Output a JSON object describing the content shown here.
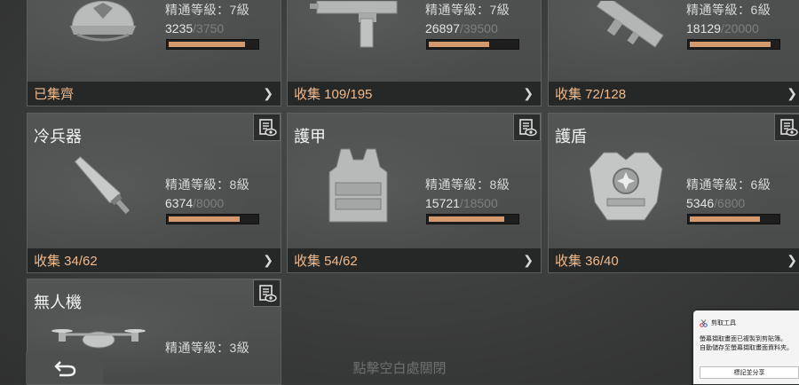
{
  "cards": [
    {
      "title": "",
      "level": "精通等級：7級",
      "exp_current": "3235",
      "exp_max": "/3750",
      "progress": 0.86,
      "collect": "已集齊",
      "icon": "helmet-icon"
    },
    {
      "title": "",
      "level": "精通等級：7級",
      "exp_current": "26897",
      "exp_max": "/39500",
      "progress": 0.68,
      "collect": "收集 109/195",
      "icon": "gun-icon"
    },
    {
      "title": "",
      "level": "精通等級：6級",
      "exp_current": "18129",
      "exp_max": "/20000",
      "progress": 0.91,
      "collect": "收集 72/128",
      "icon": "launcher-icon"
    },
    {
      "title": "冷兵器",
      "level": "精通等級：8級",
      "exp_current": "6374",
      "exp_max": "/8000",
      "progress": 0.8,
      "collect": "收集 34/62",
      "icon": "blade-icon"
    },
    {
      "title": "護甲",
      "level": "精通等級：8級",
      "exp_current": "15721",
      "exp_max": "/18500",
      "progress": 0.85,
      "collect": "收集 54/62",
      "icon": "armor-vest-icon"
    },
    {
      "title": "護盾",
      "level": "精通等級：6級",
      "exp_current": "5346",
      "exp_max": "/6800",
      "progress": 0.79,
      "collect": "收集 36/40",
      "icon": "shield-armor-icon"
    },
    {
      "title": "無人機",
      "level": "精通等級：3級",
      "icon": "drone-icon"
    }
  ],
  "bottom_hint": "點擊空白處關閉",
  "back_icon": "back-arrow-icon",
  "toast": {
    "app": "剪取工具",
    "message_line1": "螢幕擷取畫面已複製到剪貼簿。",
    "message_line2": "自動儲存至螢幕擷取畫面資料夾。",
    "button": "標記並分享"
  },
  "colors": {
    "accent": "#f0b98a",
    "bar_fill": "#d49a6e"
  }
}
